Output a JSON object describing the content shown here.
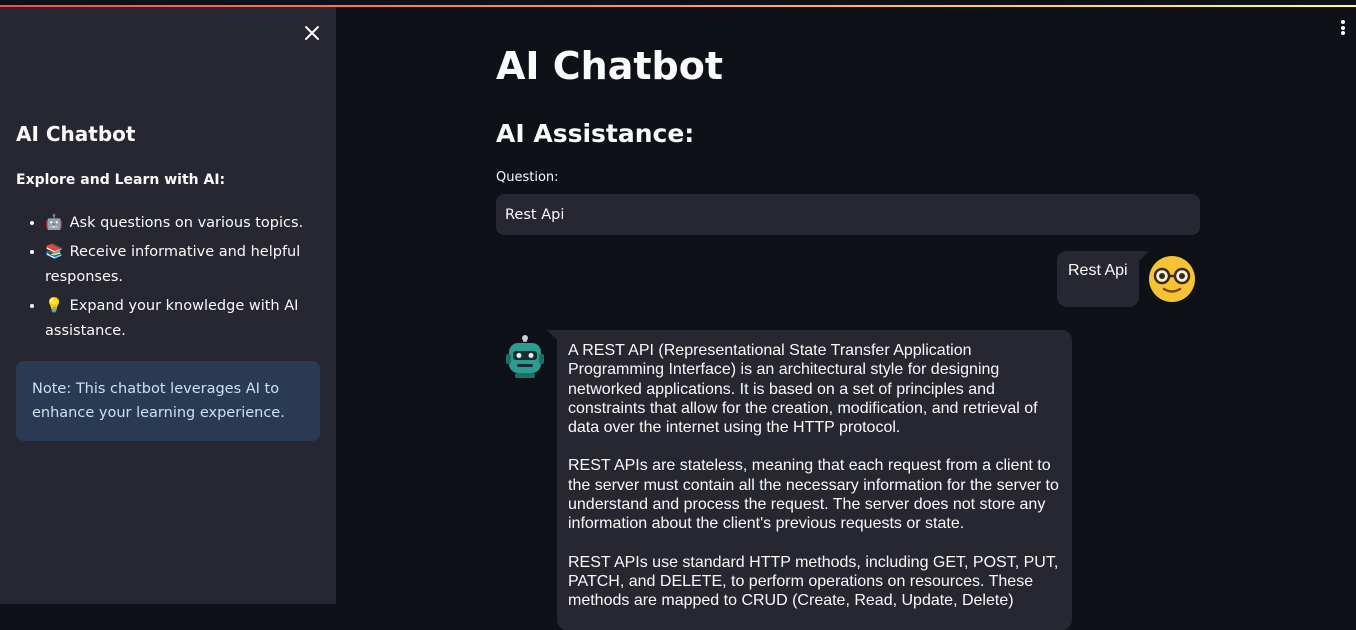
{
  "sidebar": {
    "close_icon": "close-icon",
    "title": "AI Chatbot",
    "subtitle": "Explore and Learn with AI:",
    "items": [
      {
        "emoji": "🤖",
        "text": "Ask questions on various topics."
      },
      {
        "emoji": "📚",
        "text": "Receive informative and helpful responses."
      },
      {
        "emoji": "💡",
        "text": "Expand your knowledge with AI assistance."
      }
    ],
    "note": "Note: This chatbot leverages AI to enhance your learning experience."
  },
  "main": {
    "title": "AI Chatbot",
    "section_title": "AI Assistance:",
    "question_label": "Question:",
    "question_value": "Rest Api"
  },
  "chat": {
    "user_message": "Rest Api",
    "bot_paragraphs": [
      "A REST API (Representational State Transfer Application Programming Interface) is an architectural style for designing networked applications. It is based on a set of principles and constraints that allow for the creation, modification, and retrieval of data over the internet using the HTTP protocol.",
      "REST APIs are stateless, meaning that each request from a client to the server must contain all the necessary information for the server to understand and process the request. The server does not store any information about the client's previous requests or state.",
      "REST APIs use standard HTTP methods, including GET, POST, PUT, PATCH, and DELETE, to perform operations on resources. These methods are mapped to CRUD (Create, Read, Update, Delete)"
    ]
  },
  "colors": {
    "background": "#0e1117",
    "sidebar": "#262730",
    "note_bg": "#2a3a52",
    "note_text": "#c7e0fb",
    "accent_gradient": [
      "#ff4b4b",
      "#fffd80"
    ]
  }
}
